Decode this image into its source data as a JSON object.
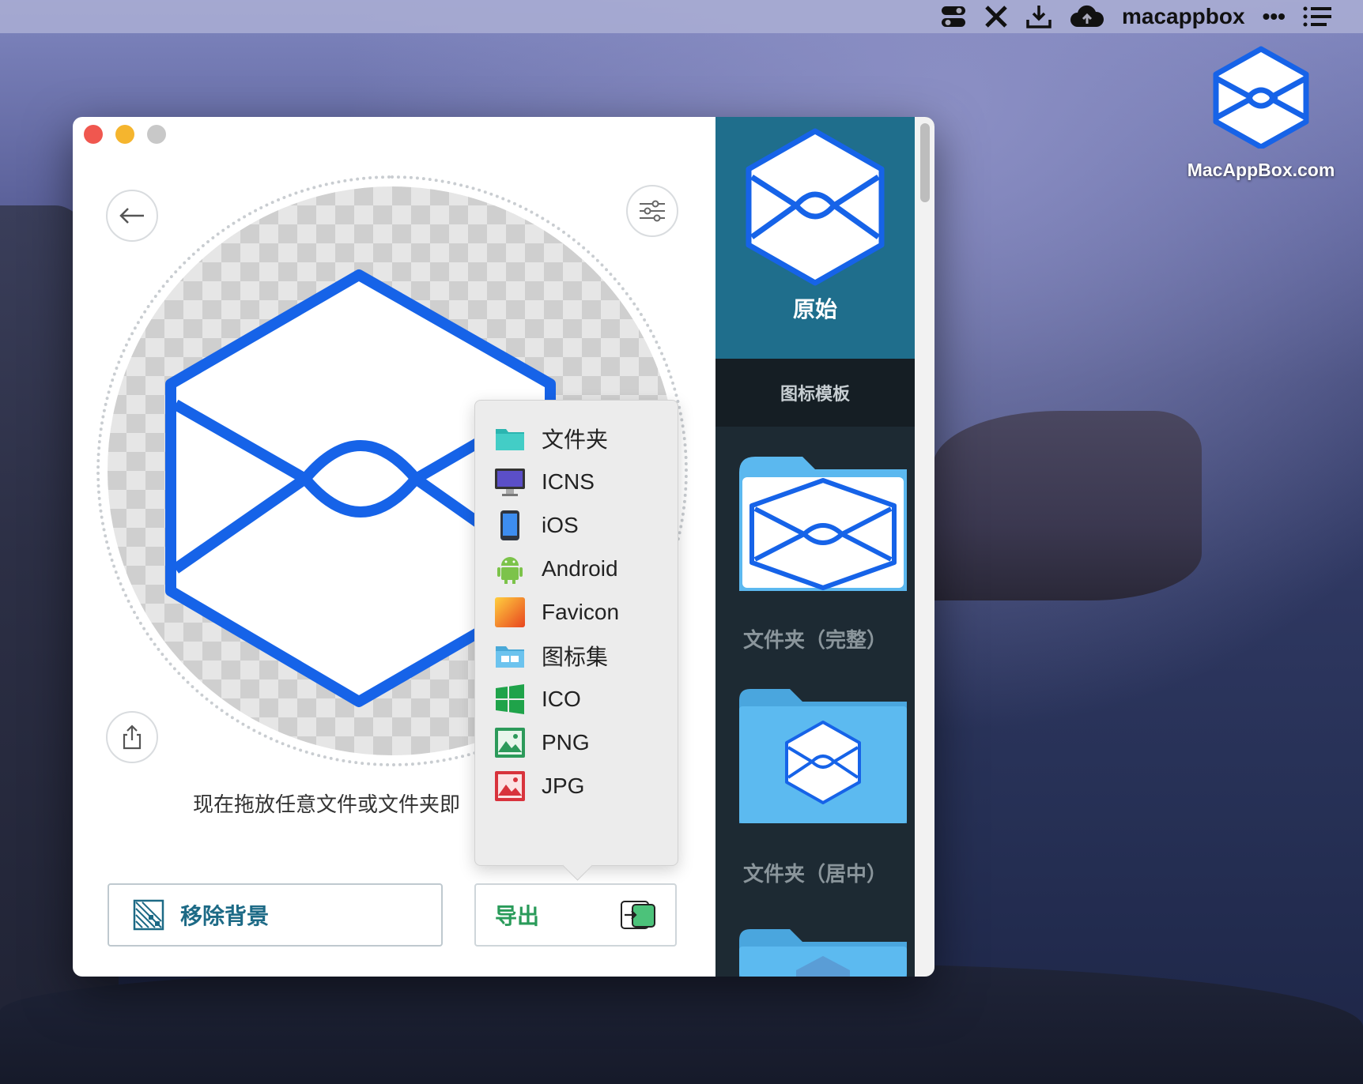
{
  "menubar": {
    "items": [
      "control-center-icon",
      "x-icon",
      "download-tray-icon",
      "cloud-icon"
    ],
    "username": "macappbox",
    "more": "•••"
  },
  "desktop": {
    "icon_label": "MacAppBox.com"
  },
  "window": {
    "drop_hint": "现在拖放任意文件或文件夹即",
    "remove_bg_label": "移除背景",
    "export_label": "导出",
    "export_menu": [
      {
        "label": "文件夹",
        "icon": "folder-teal-icon"
      },
      {
        "label": "ICNS",
        "icon": "monitor-icon"
      },
      {
        "label": "iOS",
        "icon": "phone-icon"
      },
      {
        "label": "Android",
        "icon": "android-icon"
      },
      {
        "label": "Favicon",
        "icon": "favicon-icon"
      },
      {
        "label": "图标集",
        "icon": "iconset-folder-icon"
      },
      {
        "label": "ICO",
        "icon": "windows-icon"
      },
      {
        "label": "PNG",
        "icon": "png-image-icon"
      },
      {
        "label": "JPG",
        "icon": "jpg-image-icon"
      }
    ],
    "sidebar": {
      "original_label": "原始",
      "templates_label": "图标模板",
      "thumbs": [
        {
          "label": "文件夹（完整）"
        },
        {
          "label": "文件夹（居中）"
        }
      ]
    }
  },
  "colors": {
    "accent_blue": "#1663e8",
    "sidebar_teal": "#1f6e8c",
    "export_green": "#2a9b5a"
  }
}
